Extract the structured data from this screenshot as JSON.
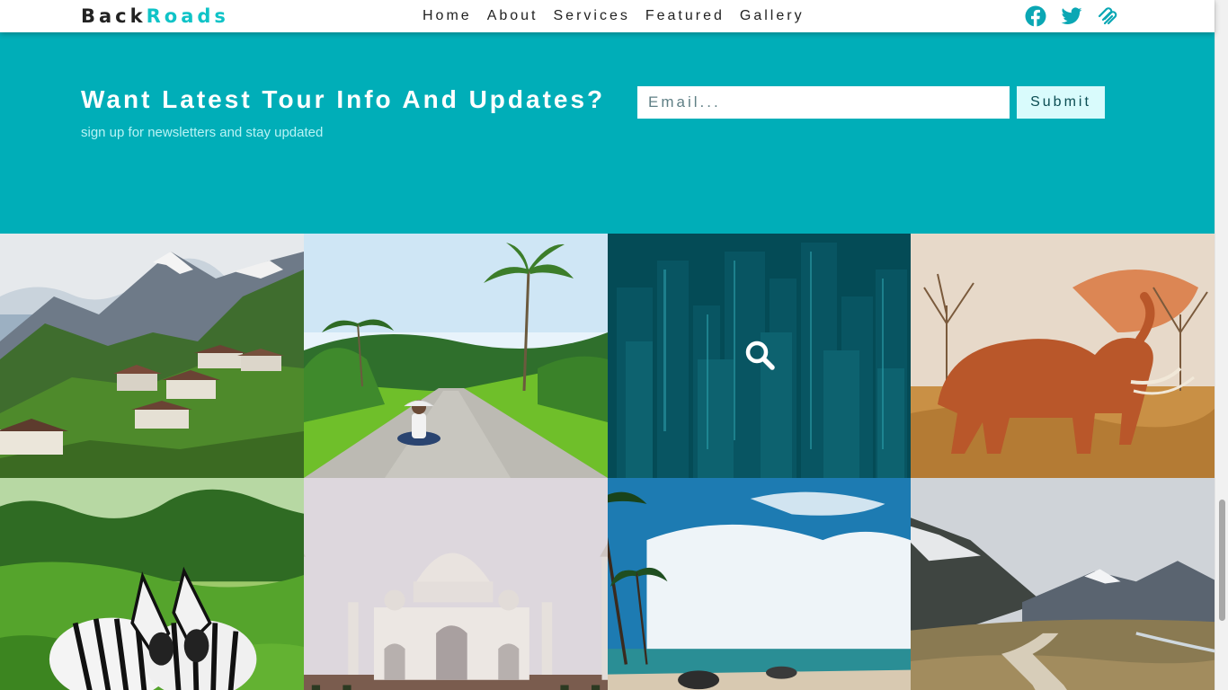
{
  "brand": {
    "part1": "Back",
    "part2": "Roads",
    "accent": "#0fc3c7"
  },
  "nav": {
    "items": [
      "Home",
      "About",
      "Services",
      "Featured",
      "Gallery"
    ]
  },
  "social": [
    {
      "icon": "facebook-icon"
    },
    {
      "icon": "twitter-icon"
    },
    {
      "icon": "squarespace-icon"
    }
  ],
  "newsletter": {
    "title": "Want Latest Tour Info And Updates?",
    "subtitle": "sign up for newsletters and stay updated",
    "email_placeholder": "Email...",
    "submit_label": "Submit",
    "background": "#00aeb8"
  },
  "gallery": {
    "images": [
      "mountain-village",
      "tropical-road",
      "city-skyline",
      "elephant",
      "zebras",
      "taj-mahal",
      "beach",
      "mountain-boardwalk"
    ],
    "hovered_icon": "search-icon"
  }
}
